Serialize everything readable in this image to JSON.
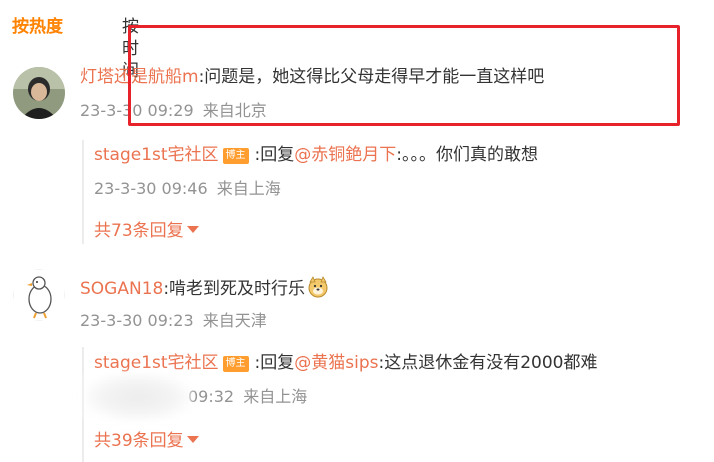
{
  "tabs": {
    "hot": "按热度",
    "time": "按时间"
  },
  "comments": [
    {
      "username": "灯塔还是航船m",
      "text": ":问题是，她这得比父母走得早才能一直这样吧",
      "time": "23-3-30 09:29",
      "location": "来自北京",
      "reply": {
        "username": "stage1st宅社区",
        "badge": "博主",
        "prefix": ":回复",
        "mention": "@赤铜銫月下",
        "text": ":。。。你们真的敢想",
        "time": "23-3-30 09:46",
        "location": "来自上海"
      },
      "more": "共73条回复"
    },
    {
      "username": "SOGAN18",
      "text": ":啃老到死及时行乐",
      "time": "23-3-30 09:23",
      "location": "来自天津",
      "reply": {
        "username": "stage1st宅社区",
        "badge": "博主",
        "prefix": ":回复",
        "mention": "@黄猫sips",
        "text": ":这点退休金有没有2000都难",
        "time": "09:32",
        "location": "来自上海"
      },
      "more": "共39条回复"
    }
  ],
  "colors": {
    "accent": "#ff8200",
    "username": "#eb7350",
    "highlight": "#e8222b",
    "meta": "#939393"
  }
}
